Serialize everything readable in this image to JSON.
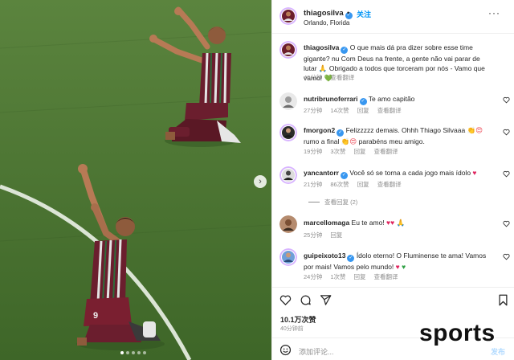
{
  "post": {
    "username": "thiagosilva",
    "follow_label": "关注",
    "separator": "•",
    "location": "Orlando, Florida",
    "more_label": "···",
    "caption_text": "O que mais dá pra dizer sobre esse time gigante? nu Com Deus na frente, a gente não vai parar de lutar 🙏 Obrigado a todos que torceram por nós - Vamo que vamo! 💚",
    "caption_time": "40分钟",
    "caption_translate": "查看翻译"
  },
  "comments": [
    {
      "username": "nutribrunoferrari",
      "text": "Te amo capitão",
      "time": "27分钟",
      "likes": "14次赞",
      "reply": "回复",
      "translate": "查看翻译"
    },
    {
      "username": "fmorgon2",
      "text_1": "Felizzzzz demais. Ohhh Thiago Silvaaa ",
      "text_2": " rumo a final ",
      "text_3": " parabéns meu amigo.",
      "time": "19分钟",
      "likes": "3次赞",
      "reply": "回复",
      "translate": "查看翻译"
    },
    {
      "username": "yancantorr",
      "text": "Você só se torna a cada jogo mais ídolo ",
      "time": "21分钟",
      "likes": "86次赞",
      "reply": "回复",
      "translate": "查看翻译"
    },
    {
      "username": "marcellomaga",
      "text": "Eu te amo! ",
      "time": "25分钟",
      "reply": "回复"
    },
    {
      "username": "guipeixoto13",
      "text": "Ídolo eterno! O Fluminense te ama! Vamos por mais! Vamos pelo mundo! ",
      "time": "24分钟",
      "likes": "1次赞",
      "reply": "回复",
      "translate": "查看翻译"
    }
  ],
  "view_replies": "查看回复 (2)",
  "stats": {
    "likes": "10.1万次赞",
    "ago": "40分钟前"
  },
  "composer": {
    "placeholder": "添加评论...",
    "post_label": "发布"
  },
  "carousel": {
    "next_icon": "chevron-right-icon",
    "dots": 5,
    "active_dot": 1
  },
  "watermark": "sports",
  "colors": {
    "accent": "#0095f6",
    "verified": "#3897f0",
    "like_red": "#ed4956",
    "muted": "#8e8e8e"
  }
}
